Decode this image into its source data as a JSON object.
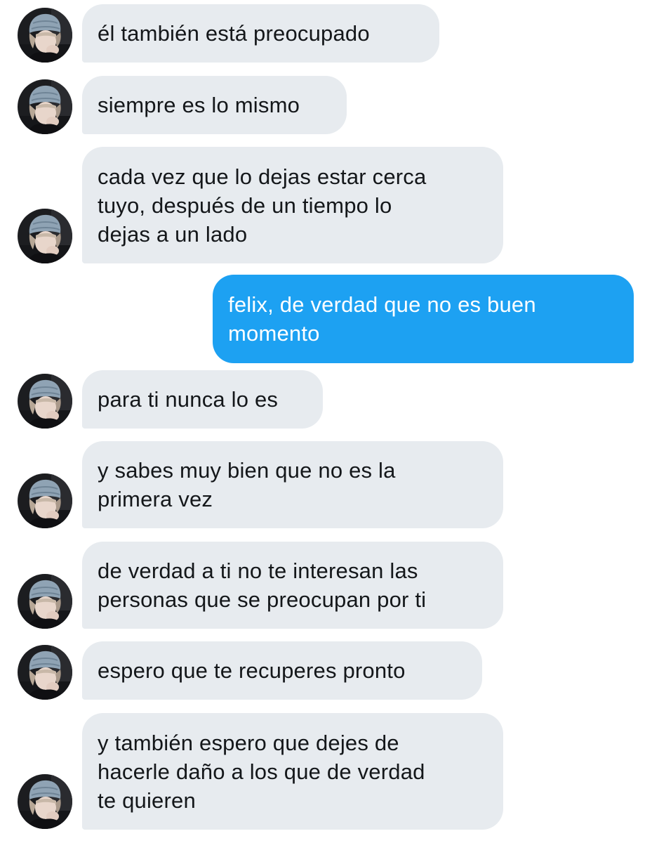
{
  "conversation": {
    "messages": [
      {
        "sender": "them",
        "text": "él también está preocupado"
      },
      {
        "sender": "them",
        "text": "siempre es lo mismo"
      },
      {
        "sender": "them",
        "text": "cada vez que lo dejas estar cerca\ntuyo, después de un tiempo lo\ndejas a un lado"
      },
      {
        "sender": "me",
        "text": "felix, de verdad que no es buen\nmomento"
      },
      {
        "sender": "them",
        "text": "para ti nunca lo es"
      },
      {
        "sender": "them",
        "text": "y sabes muy bien que no es la\nprimera vez"
      },
      {
        "sender": "them",
        "text": "de verdad a ti no te interesan las\npersonas que se preocupan por ti"
      },
      {
        "sender": "them",
        "text": "espero que te recuperes pronto"
      },
      {
        "sender": "them",
        "text": "y también espero que dejes de\nhacerle daño a los que de verdad\nte quieren"
      }
    ],
    "avatar_icon": "profile-photo-avatar",
    "colors": {
      "incoming_bubble": "#e7ebef",
      "incoming_text": "#14171a",
      "outgoing_bubble": "#1da1f2",
      "outgoing_text": "#ffffff"
    }
  }
}
